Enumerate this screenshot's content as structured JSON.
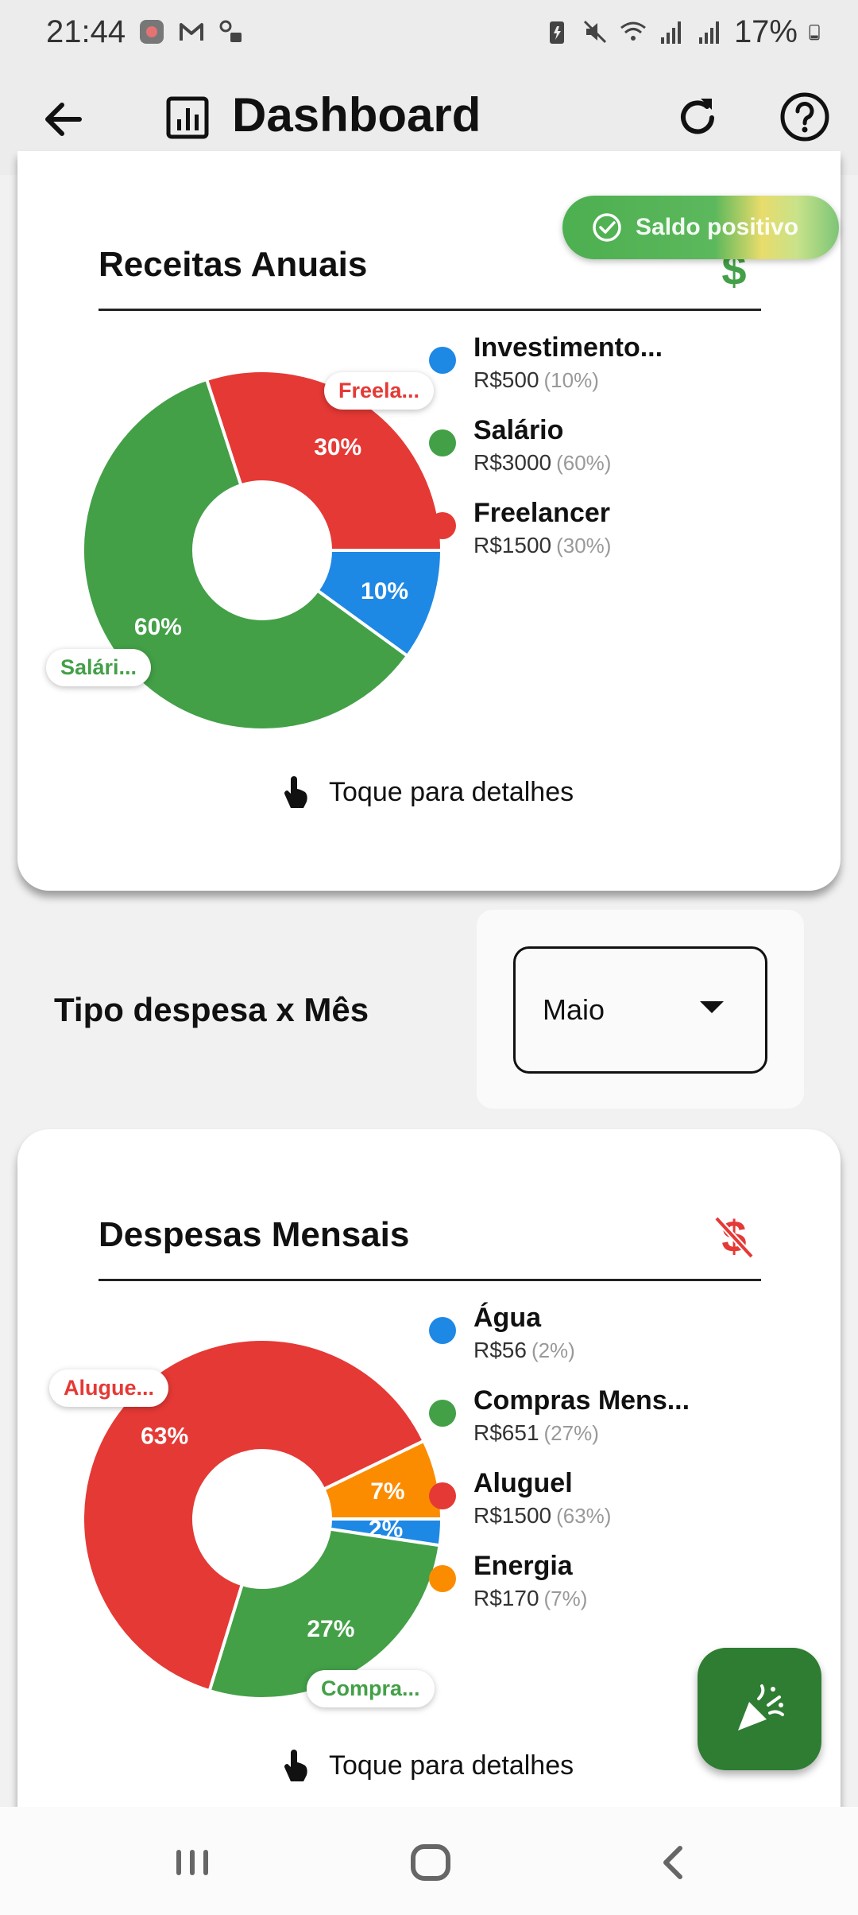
{
  "status_bar": {
    "time": "21:44",
    "battery": "17%",
    "icons": [
      "app-icon",
      "gmail-icon",
      "key-icon",
      "battery-saver-icon",
      "mute-icon",
      "wifi-icon",
      "signal-icon",
      "signal-icon",
      "battery-icon"
    ]
  },
  "app_bar": {
    "title": "Dashboard",
    "icons": [
      "back-arrow-icon",
      "bar-chart-icon",
      "refresh-icon",
      "help-icon"
    ]
  },
  "toast": {
    "text": "Saldo positivo",
    "icon": "check-circle-icon"
  },
  "receitas": {
    "title": "Receitas Anuais",
    "icon": "dollar-icon",
    "tap_hint": "Toque para detalhes",
    "legend": [
      {
        "name": "Investimento...",
        "value": "R$500",
        "pct": "(10%)",
        "color": "#1e88e5"
      },
      {
        "name": "Salário",
        "value": "R$3000",
        "pct": "(60%)",
        "color": "#43a047"
      },
      {
        "name": "Freelancer",
        "value": "R$1500",
        "pct": "(30%)",
        "color": "#e53935"
      }
    ],
    "callouts": {
      "freela": "Freela...",
      "salario": "Salári..."
    }
  },
  "filter": {
    "title": "Tipo despesa x Mês",
    "selected": "Maio"
  },
  "despesas": {
    "title": "Despesas Mensais",
    "icon": "dollar-off-icon",
    "tap_hint": "Toque para detalhes",
    "legend": [
      {
        "name": "Água",
        "value": "R$56",
        "pct": "(2%)",
        "color": "#1e88e5"
      },
      {
        "name": "Compras Mens...",
        "value": "R$651",
        "pct": "(27%)",
        "color": "#43a047"
      },
      {
        "name": "Aluguel",
        "value": "R$1500",
        "pct": "(63%)",
        "color": "#e53935"
      },
      {
        "name": "Energia",
        "value": "R$170",
        "pct": "(7%)",
        "color": "#fb8c00"
      }
    ],
    "callouts": {
      "aluguel": "Alugue...",
      "compras": "Compra..."
    }
  },
  "chart_data": [
    {
      "type": "pie",
      "title": "Receitas Anuais",
      "categories": [
        "Investimento...",
        "Salário",
        "Freelancer"
      ],
      "values": [
        500,
        3000,
        1500
      ],
      "percent_labels": [
        "10%",
        "60%",
        "30%"
      ],
      "colors": [
        "#1e88e5",
        "#43a047",
        "#e53935"
      ]
    },
    {
      "type": "pie",
      "title": "Despesas Mensais",
      "categories": [
        "Água",
        "Compras Mens...",
        "Aluguel",
        "Energia"
      ],
      "values": [
        56,
        651,
        1500,
        170
      ],
      "percent_labels": [
        "2%",
        "27%",
        "63%",
        "7%"
      ],
      "colors": [
        "#1e88e5",
        "#43a047",
        "#e53935",
        "#fb8c00"
      ]
    }
  ],
  "fab": {
    "icon": "party-popper-icon"
  },
  "nav_bar": {
    "icons": [
      "recent-apps-icon",
      "home-icon",
      "back-nav-icon"
    ]
  }
}
